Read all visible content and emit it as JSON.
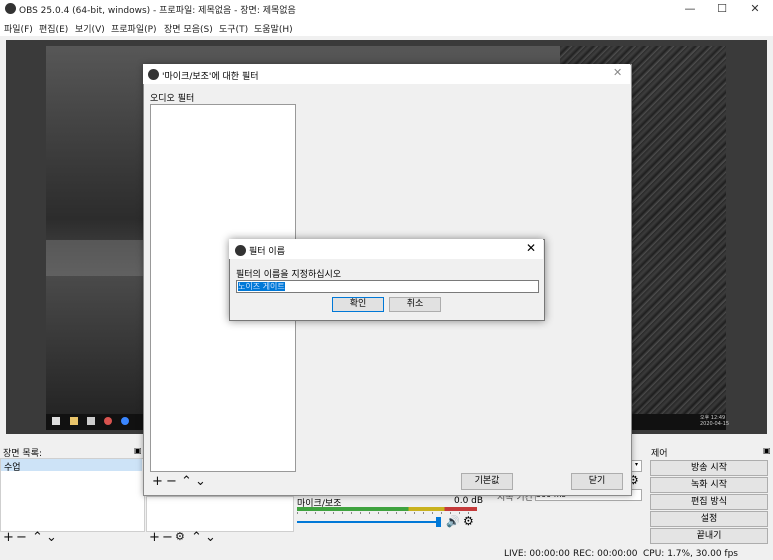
{
  "window": {
    "title": "OBS 25.0.4 (64-bit, windows) - 프로파일: 제목없음 - 장면: 제목없음",
    "minimize": "—",
    "maximize": "☐",
    "close": "✕"
  },
  "menu": [
    "파일(F)",
    "편집(E)",
    "보기(V)",
    "프로파일(P)",
    "장면 모음(S)",
    "도구(T)",
    "도움말(H)"
  ],
  "screenshot_taskbar": {
    "time": "오후 12:49",
    "date": "2020-04-15"
  },
  "filter_dialog": {
    "title": "'마이크/보조'에 대한 필터",
    "section": "오디오 필터",
    "defaults_button": "기본값",
    "close_button": "닫기",
    "close_x": "✕"
  },
  "name_dialog": {
    "title": "필터 이름",
    "prompt": "필터의 이름을 지정하십시오",
    "value": "노이즈 게이트",
    "ok": "확인",
    "cancel": "취소",
    "close_x": "✕"
  },
  "scenes": {
    "title": "장면 목록",
    "item": "수업"
  },
  "mixer": {
    "source": "마이크/보조",
    "level": "0.0 dB"
  },
  "transitions": {
    "duration_label": "지속 기간",
    "duration_value": "300 ms"
  },
  "controls": {
    "title": "제어",
    "buttons": [
      "방송 시작",
      "녹화 시작",
      "편집 방식",
      "설정",
      "끝내기"
    ]
  },
  "status": {
    "live": "LIVE: 00:00:00",
    "rec": "REC: 00:00:00",
    "cpu": "CPU: 1.7%, 30.00 fps"
  },
  "colors": {
    "accent": "#0078d7",
    "meter_green": "#3fa33f",
    "meter_yellow": "#c9b21e",
    "meter_red": "#c43b3b"
  }
}
